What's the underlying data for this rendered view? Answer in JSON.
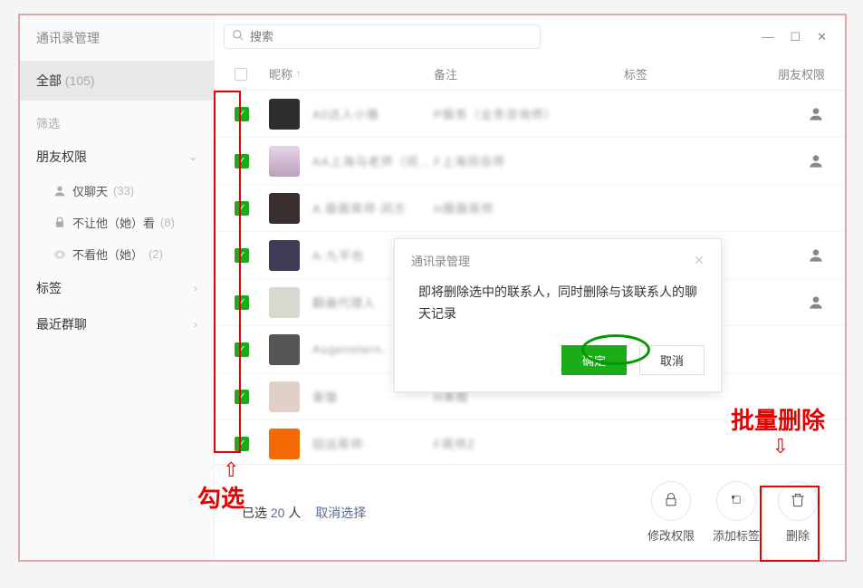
{
  "window": {
    "title": "通讯录管理"
  },
  "sidebar": {
    "all_label": "全部",
    "all_count": "(105)",
    "filter_label": "筛选",
    "perm_label": "朋友权限",
    "perm_items": [
      {
        "label": "仅聊天",
        "count": "(33)"
      },
      {
        "label": "不让他（她）看",
        "count": "(8)"
      },
      {
        "label": "不看他（她）",
        "count": "(2)"
      }
    ],
    "tag_label": "标签",
    "recent_label": "最近群聊"
  },
  "search": {
    "placeholder": "搜索"
  },
  "columns": {
    "nickname": "昵称",
    "remark": "备注",
    "tag": "标签",
    "perm": "朋友权限"
  },
  "contacts": [
    {
      "nickname": "A0达人小雅",
      "remark": "P服务（业务咨询师）",
      "checked": true,
      "has_perm_icon": true
    },
    {
      "nickname": "AA上海马老师（闵…",
      "remark": "F上海闵岳师",
      "checked": true,
      "has_perm_icon": true
    },
    {
      "nickname": "A.薇薇蒋师·闵方",
      "remark": "H薇薇蒋师",
      "checked": true,
      "has_perm_icon": false
    },
    {
      "nickname": "A·九平也",
      "remark": "",
      "checked": true,
      "has_perm_icon": true
    },
    {
      "nickname": "翻遍代理人",
      "remark": "",
      "checked": true,
      "has_perm_icon": true
    },
    {
      "nickname": "Augenstern.",
      "remark": "",
      "checked": true,
      "has_perm_icon": false
    },
    {
      "nickname": "楽璇",
      "remark": "H来程",
      "checked": true,
      "has_perm_icon": false
    },
    {
      "nickname": "招远蒋师·",
      "remark": "F蒋师Z",
      "checked": true,
      "has_perm_icon": false
    }
  ],
  "selection": {
    "prefix": "已选",
    "count": "20",
    "suffix": "人",
    "cancel": "取消选择"
  },
  "actions": {
    "modify_perm": "修改权限",
    "add_tag": "添加标签",
    "delete": "删除"
  },
  "modal": {
    "title": "通讯录管理",
    "body": "即将删除选中的联系人，同时删除与该联系人的聊天记录",
    "ok": "确定",
    "cancel": "取消"
  },
  "annotations": {
    "select": "勾选",
    "batch_delete": "批量删除"
  }
}
